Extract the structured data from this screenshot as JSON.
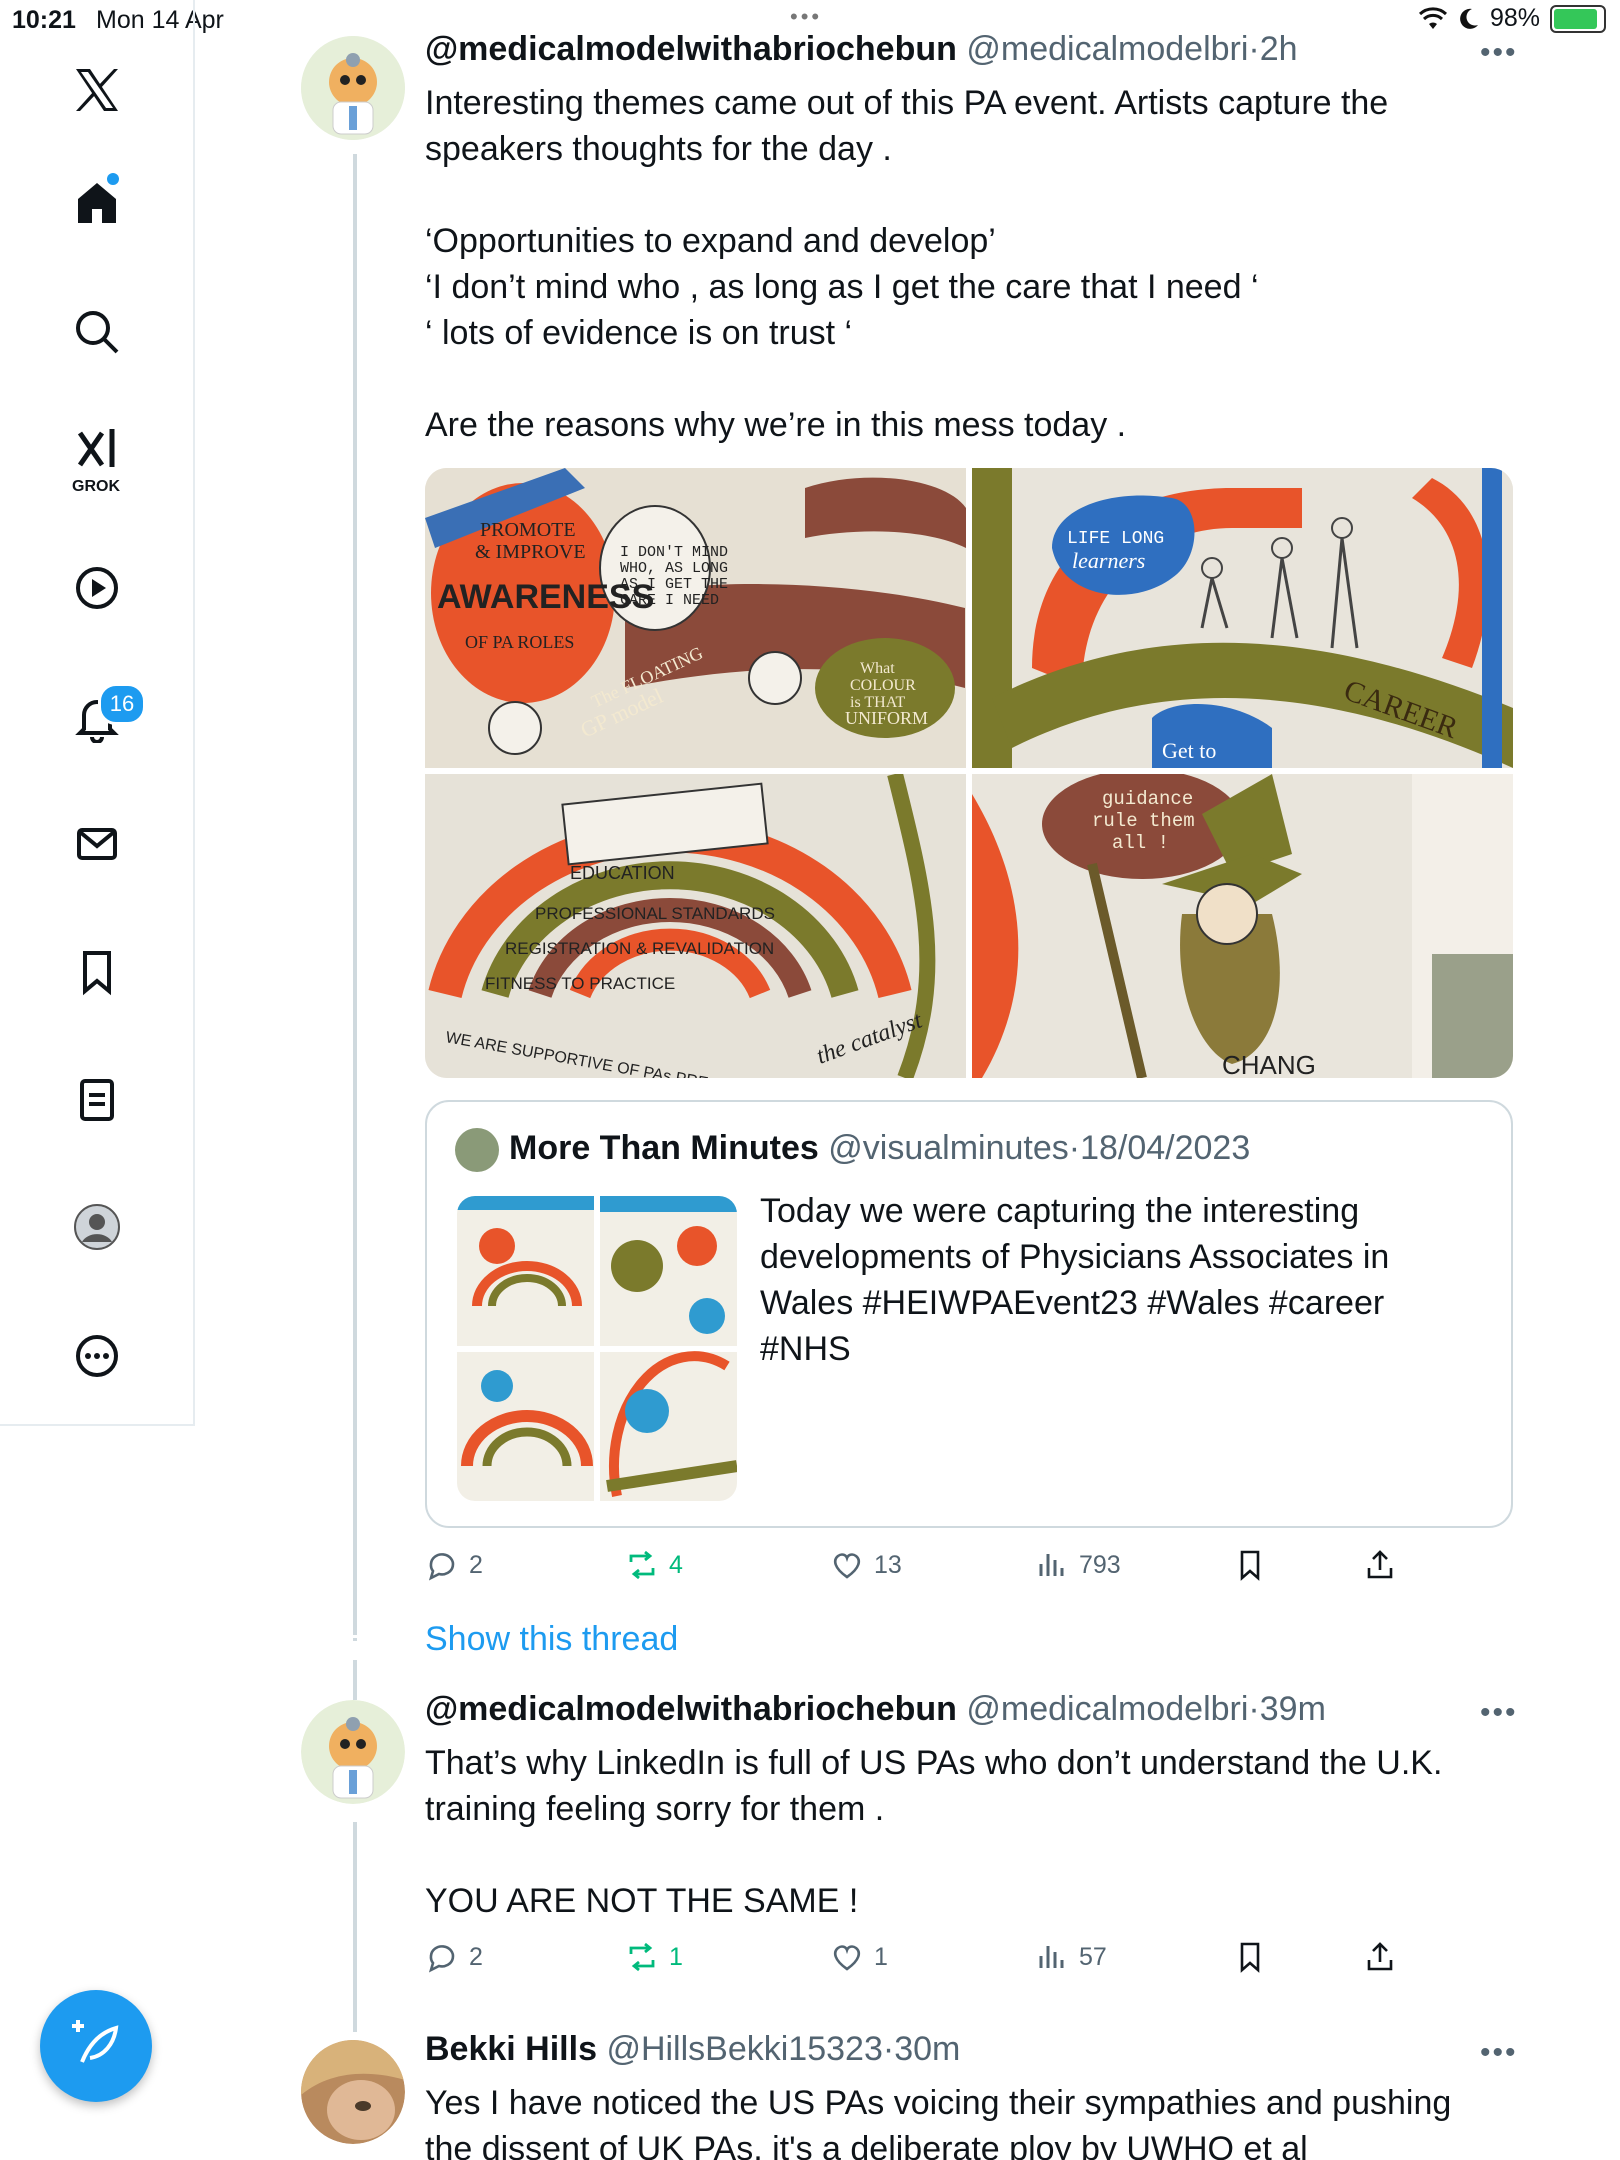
{
  "status_bar": {
    "time": "10:21",
    "date": "Mon 14 Apr",
    "battery_text": "98%",
    "battery_level": 0.98
  },
  "sidebar": {
    "items": [
      {
        "icon": "x-logo-icon"
      },
      {
        "icon": "home-icon"
      },
      {
        "icon": "search-icon"
      },
      {
        "icon": "grok-icon",
        "label": "GROK"
      },
      {
        "icon": "video-play-icon"
      },
      {
        "icon": "bell-icon",
        "badge": "16"
      },
      {
        "icon": "mail-icon"
      },
      {
        "icon": "bookmark-icon"
      },
      {
        "icon": "lists-icon"
      },
      {
        "icon": "profile-icon"
      },
      {
        "icon": "more-circle-icon"
      }
    ],
    "compose_icon": "feather-plus-icon"
  },
  "tweets": [
    {
      "name": "@medicalmodelwithabriochebun",
      "handle": "@medicalmodelbri",
      "time": "2h",
      "text_lines": [
        "Interesting themes came out of this PA event. Artists capture the",
        "speakers thoughts for the day .",
        "",
        "‘Opportunities to expand and develop’",
        "‘I don’t mind who , as long as I get the care that I need ‘",
        "‘ lots of evidence is on trust ‘",
        "",
        "Are the reasons why we’re in this mess today ."
      ],
      "media_texts": {
        "t1": [
          "PROMOTE",
          "& IMPROVE",
          "AWARENESS",
          "OF PA ROLES",
          "I DON'T MIND",
          "WHO, AS LONG",
          "AS I GET THE",
          "CARE I NEED",
          "The FLOATING",
          "GP model",
          "What",
          "COLOUR",
          "is THAT",
          "UNIFORM"
        ],
        "t2": [
          "LIFE LONG",
          "learners",
          "CAREER",
          "Get to"
        ],
        "t3": [
          "EDUCATION",
          "PROFESSIONAL STANDARDS",
          "REGISTRATION & REVALIDATION",
          "FITNESS TO PRACTICE",
          "WE ARE SUPPORTIVE OF PAs PRESCRIBING",
          "the catalyst"
        ],
        "t4": [
          "guidance",
          "rule them",
          "all !",
          "CHANG"
        ]
      },
      "quote": {
        "name": "More Than Minutes",
        "handle": "@visualminutes",
        "date": "18/04/2023",
        "text": "Today we were capturing the interesting developments of Physicians Associates in Wales #HEIWPAEvent23 #Wales #career #NHS"
      },
      "actions": {
        "replies": "2",
        "reposts": "4",
        "likes": "13",
        "views": "793"
      },
      "show_thread": "Show this thread"
    },
    {
      "name": "@medicalmodelwithabriochebun",
      "handle": "@medicalmodelbri",
      "time": "39m",
      "text_lines": [
        "That’s why LinkedIn is full of US PAs who don’t understand the U.K.",
        "training feeling sorry for them .",
        "",
        "YOU ARE NOT THE SAME !"
      ],
      "actions": {
        "replies": "2",
        "reposts": "1",
        "likes": "1",
        "views": "57"
      }
    },
    {
      "name": "Bekki Hills",
      "handle": "@HillsBekki15323",
      "time": "30m",
      "text_lines": [
        "Yes I have noticed the US PAs voicing their sympathies and pushing",
        "the dissent of UK PAs, it's a deliberate ploy by UWHO et al"
      ]
    }
  ],
  "colors": {
    "accent": "#1d9bf0",
    "repost_green": "#00ba7c",
    "muted": "#536471",
    "border": "#cfd9de"
  }
}
